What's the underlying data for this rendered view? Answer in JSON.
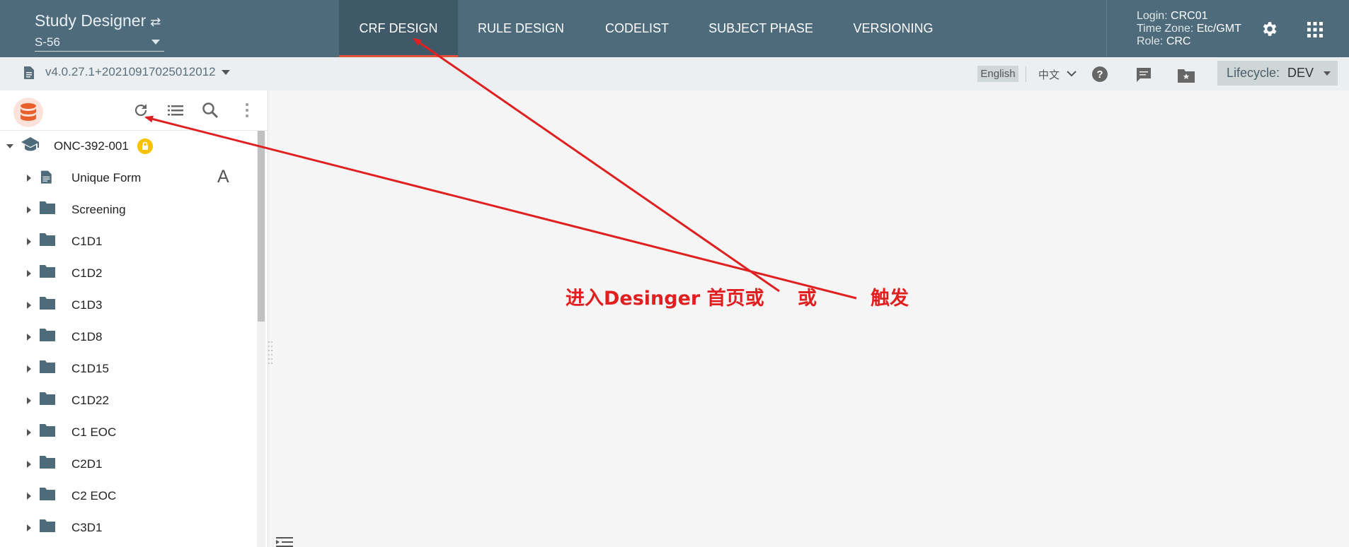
{
  "app": {
    "title": "Study Designer",
    "study_id": "S-56"
  },
  "tabs": [
    {
      "label": "CRF DESIGN",
      "active": true
    },
    {
      "label": "RULE DESIGN",
      "active": false
    },
    {
      "label": "CODELIST",
      "active": false
    },
    {
      "label": "SUBJECT PHASE",
      "active": false
    },
    {
      "label": "VERSIONING",
      "active": false
    }
  ],
  "user": {
    "login_label": "Login:",
    "login": "CRC01",
    "tz_label": "Time Zone:",
    "tz": "Etc/GMT",
    "role_label": "Role:",
    "role": "CRC"
  },
  "subbar": {
    "version": "v4.0.27.1+20210917025012012",
    "lang_en": "English",
    "lang_zh": "中文",
    "lifecycle_label": "Lifecycle:",
    "lifecycle_value": "DEV"
  },
  "tree": {
    "root": "ONC-392-001",
    "form_badge": "A",
    "items": [
      "Unique Form",
      "Screening",
      "C1D1",
      "C1D2",
      "C1D3",
      "C1D8",
      "C1D15",
      "C1D22",
      "C1 EOC",
      "C2D1",
      "C2 EOC",
      "C3D1"
    ]
  },
  "annotation": {
    "part1": "进入Desinger 首页或",
    "part2": "或",
    "part3": "触发",
    "color": "#e02020"
  },
  "colors": {
    "topbar": "#4e6b7c",
    "active_tab": "#3f5968",
    "accent": "#e0533a",
    "lock": "#f7c200"
  }
}
